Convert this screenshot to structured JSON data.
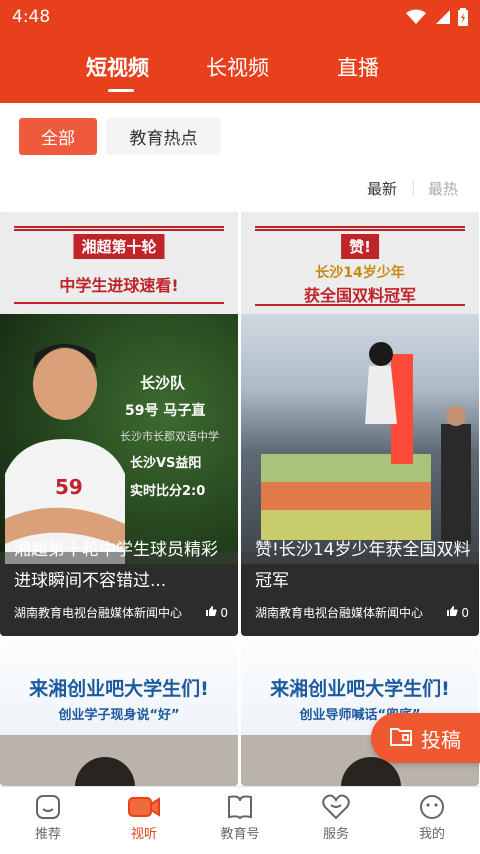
{
  "status_bar": {
    "time": "4:48",
    "icons": [
      "wifi-icon",
      "signal-icon",
      "battery-icon"
    ]
  },
  "header": {
    "tabs": [
      {
        "label": "短视频",
        "active": true
      },
      {
        "label": "长视频",
        "active": false
      },
      {
        "label": "直播",
        "active": false
      }
    ],
    "accent_color": "#e8401c"
  },
  "filters": {
    "chips": [
      {
        "label": "全部",
        "active": true
      },
      {
        "label": "教育热点",
        "active": false
      }
    ]
  },
  "sort": {
    "options": [
      {
        "label": "最新",
        "active": true
      },
      {
        "label": "最热",
        "active": false
      }
    ]
  },
  "cards": [
    {
      "tag": "湘超第十轮",
      "headline": "中学生进球速看!",
      "photo_texts": [
        "长沙队",
        "59号 马子直",
        "长沙市长郡双语中学",
        "长沙VS益阳",
        "实时比分2:0"
      ],
      "title": "湘超第十轮中学生球员精彩进球瞬间不容错过...",
      "source": "湖南教育电视台融媒体新闻中心",
      "likes": "0"
    },
    {
      "tag": "赞!",
      "headline_line1": "长沙14岁少年",
      "headline_line2": "获全国双料冠军",
      "title": "赞!长沙14岁少年获全国双料冠军",
      "source": "湖南教育电视台融媒体新闻中心",
      "likes": "0"
    },
    {
      "banner_big": "来湘创业吧大学生们!",
      "banner_small": "创业学子现身说“好”"
    },
    {
      "banner_big": "来湘创业吧大学生们!",
      "banner_small": "创业导师喊话“兜底”"
    }
  ],
  "fab": {
    "label": "投稿",
    "icon": "folder-icon"
  },
  "bottom_nav": [
    {
      "label": "推荐",
      "icon": "smile-box-icon",
      "active": false
    },
    {
      "label": "视听",
      "icon": "video-camera-icon",
      "active": true
    },
    {
      "label": "教育号",
      "icon": "book-icon",
      "active": false
    },
    {
      "label": "服务",
      "icon": "heart-icon",
      "active": false
    },
    {
      "label": "我的",
      "icon": "face-icon",
      "active": false
    }
  ]
}
